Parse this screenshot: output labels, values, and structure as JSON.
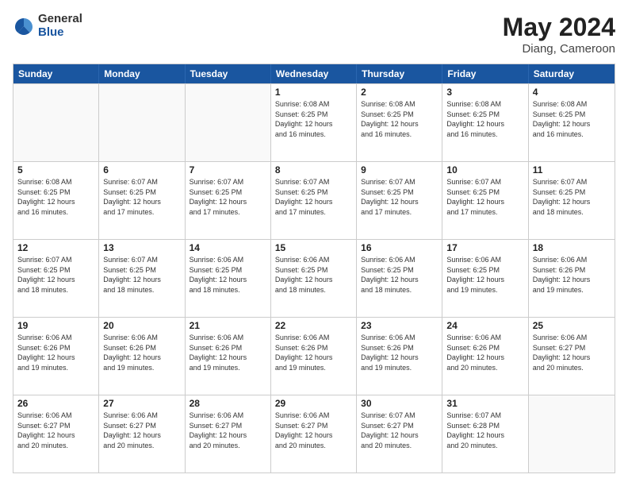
{
  "logo": {
    "general": "General",
    "blue": "Blue"
  },
  "title": "May 2024",
  "subtitle": "Diang, Cameroon",
  "header_days": [
    "Sunday",
    "Monday",
    "Tuesday",
    "Wednesday",
    "Thursday",
    "Friday",
    "Saturday"
  ],
  "rows": [
    [
      {
        "day": "",
        "info": ""
      },
      {
        "day": "",
        "info": ""
      },
      {
        "day": "",
        "info": ""
      },
      {
        "day": "1",
        "info": "Sunrise: 6:08 AM\nSunset: 6:25 PM\nDaylight: 12 hours\nand 16 minutes."
      },
      {
        "day": "2",
        "info": "Sunrise: 6:08 AM\nSunset: 6:25 PM\nDaylight: 12 hours\nand 16 minutes."
      },
      {
        "day": "3",
        "info": "Sunrise: 6:08 AM\nSunset: 6:25 PM\nDaylight: 12 hours\nand 16 minutes."
      },
      {
        "day": "4",
        "info": "Sunrise: 6:08 AM\nSunset: 6:25 PM\nDaylight: 12 hours\nand 16 minutes."
      }
    ],
    [
      {
        "day": "5",
        "info": "Sunrise: 6:08 AM\nSunset: 6:25 PM\nDaylight: 12 hours\nand 16 minutes."
      },
      {
        "day": "6",
        "info": "Sunrise: 6:07 AM\nSunset: 6:25 PM\nDaylight: 12 hours\nand 17 minutes."
      },
      {
        "day": "7",
        "info": "Sunrise: 6:07 AM\nSunset: 6:25 PM\nDaylight: 12 hours\nand 17 minutes."
      },
      {
        "day": "8",
        "info": "Sunrise: 6:07 AM\nSunset: 6:25 PM\nDaylight: 12 hours\nand 17 minutes."
      },
      {
        "day": "9",
        "info": "Sunrise: 6:07 AM\nSunset: 6:25 PM\nDaylight: 12 hours\nand 17 minutes."
      },
      {
        "day": "10",
        "info": "Sunrise: 6:07 AM\nSunset: 6:25 PM\nDaylight: 12 hours\nand 17 minutes."
      },
      {
        "day": "11",
        "info": "Sunrise: 6:07 AM\nSunset: 6:25 PM\nDaylight: 12 hours\nand 18 minutes."
      }
    ],
    [
      {
        "day": "12",
        "info": "Sunrise: 6:07 AM\nSunset: 6:25 PM\nDaylight: 12 hours\nand 18 minutes."
      },
      {
        "day": "13",
        "info": "Sunrise: 6:07 AM\nSunset: 6:25 PM\nDaylight: 12 hours\nand 18 minutes."
      },
      {
        "day": "14",
        "info": "Sunrise: 6:06 AM\nSunset: 6:25 PM\nDaylight: 12 hours\nand 18 minutes."
      },
      {
        "day": "15",
        "info": "Sunrise: 6:06 AM\nSunset: 6:25 PM\nDaylight: 12 hours\nand 18 minutes."
      },
      {
        "day": "16",
        "info": "Sunrise: 6:06 AM\nSunset: 6:25 PM\nDaylight: 12 hours\nand 18 minutes."
      },
      {
        "day": "17",
        "info": "Sunrise: 6:06 AM\nSunset: 6:25 PM\nDaylight: 12 hours\nand 19 minutes."
      },
      {
        "day": "18",
        "info": "Sunrise: 6:06 AM\nSunset: 6:26 PM\nDaylight: 12 hours\nand 19 minutes."
      }
    ],
    [
      {
        "day": "19",
        "info": "Sunrise: 6:06 AM\nSunset: 6:26 PM\nDaylight: 12 hours\nand 19 minutes."
      },
      {
        "day": "20",
        "info": "Sunrise: 6:06 AM\nSunset: 6:26 PM\nDaylight: 12 hours\nand 19 minutes."
      },
      {
        "day": "21",
        "info": "Sunrise: 6:06 AM\nSunset: 6:26 PM\nDaylight: 12 hours\nand 19 minutes."
      },
      {
        "day": "22",
        "info": "Sunrise: 6:06 AM\nSunset: 6:26 PM\nDaylight: 12 hours\nand 19 minutes."
      },
      {
        "day": "23",
        "info": "Sunrise: 6:06 AM\nSunset: 6:26 PM\nDaylight: 12 hours\nand 19 minutes."
      },
      {
        "day": "24",
        "info": "Sunrise: 6:06 AM\nSunset: 6:26 PM\nDaylight: 12 hours\nand 20 minutes."
      },
      {
        "day": "25",
        "info": "Sunrise: 6:06 AM\nSunset: 6:27 PM\nDaylight: 12 hours\nand 20 minutes."
      }
    ],
    [
      {
        "day": "26",
        "info": "Sunrise: 6:06 AM\nSunset: 6:27 PM\nDaylight: 12 hours\nand 20 minutes."
      },
      {
        "day": "27",
        "info": "Sunrise: 6:06 AM\nSunset: 6:27 PM\nDaylight: 12 hours\nand 20 minutes."
      },
      {
        "day": "28",
        "info": "Sunrise: 6:06 AM\nSunset: 6:27 PM\nDaylight: 12 hours\nand 20 minutes."
      },
      {
        "day": "29",
        "info": "Sunrise: 6:06 AM\nSunset: 6:27 PM\nDaylight: 12 hours\nand 20 minutes."
      },
      {
        "day": "30",
        "info": "Sunrise: 6:07 AM\nSunset: 6:27 PM\nDaylight: 12 hours\nand 20 minutes."
      },
      {
        "day": "31",
        "info": "Sunrise: 6:07 AM\nSunset: 6:28 PM\nDaylight: 12 hours\nand 20 minutes."
      },
      {
        "day": "",
        "info": ""
      }
    ]
  ]
}
